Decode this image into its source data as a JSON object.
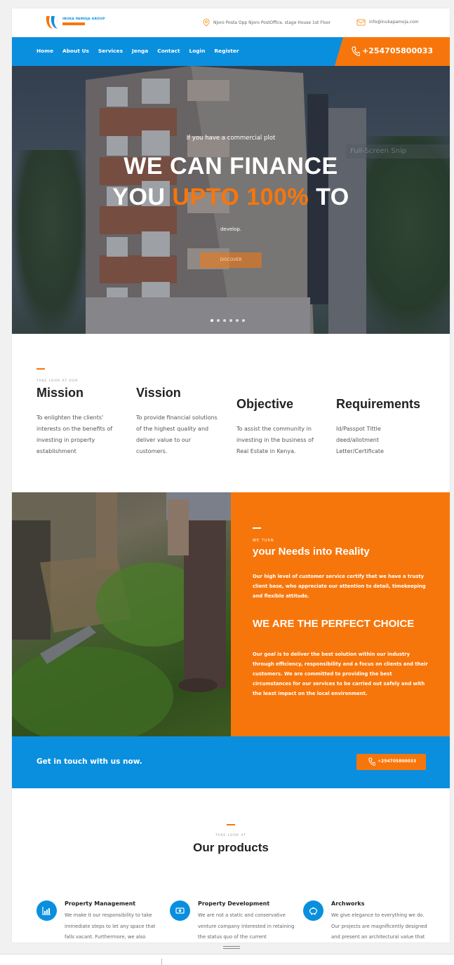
{
  "topbar": {
    "brand": "INUKA PAMOJA GROUP",
    "address": "Njoro Posta Opp Njoro PostOffice, stage House 1st Floor",
    "email": "info@inukapamoja.com"
  },
  "nav": {
    "items": [
      "Home",
      "About Us",
      "Services",
      "Jenga",
      "Contact",
      "Login",
      "Register"
    ],
    "phone": "+254705800033"
  },
  "hero": {
    "kicker": "If you have a commercial plot",
    "line1": "WE CAN FINANCE",
    "line2_a": "YOU ",
    "line2_accent": "UPTO 100%",
    "line2_b": " TO",
    "sub": "develop.",
    "button": "DISCOVER",
    "overlay": "Full-Screen Snip",
    "slides": 6,
    "active_slide": 1
  },
  "mission": {
    "kicker": "TAKE LOOK AT OUR",
    "columns": [
      {
        "title": "Mission",
        "text": "To enlighten the clients' interests on the benefits of investing in property establishment"
      },
      {
        "title": "Vission",
        "text": "To provide financial solutions of the highest quality and deliver value to our customers."
      },
      {
        "title": "Objective",
        "text": "To assist the community in investing in the business of Real Estate in Kenya."
      },
      {
        "title": "Requirements",
        "text": "Id/Passpot Tittle deed/allotment Letter/Certificate"
      }
    ]
  },
  "needs": {
    "kicker": "WE TURN",
    "title": "your Needs into Reality",
    "para1": "Our high level of customer service certify that we have a trusty client base, who appreciate our attention to detail, timekeeping and flexible attitude.",
    "title2": "WE ARE THE PERFECT CHOICE",
    "para2": "Our goal is to deliver the best solution within our industry through efficiency, responsibility and a focus on clients and their customers. We are committed to providing the best circumstances for our services to be carried out safely and with the least impact on the local environment."
  },
  "cta": {
    "text": "Get in touch with us now.",
    "phone": "+254705800033"
  },
  "products": {
    "kicker": "TAKE LOOK AT",
    "title": "Our products",
    "cards": [
      {
        "icon": "chart-icon",
        "title": "Property Management",
        "text": "We make it our responsibility to take immediate steps to let any space that falls vacant. Furthermore, we also undertake Project Management on"
      },
      {
        "icon": "money-icon",
        "title": "Property Development",
        "text": "We are not a static and conservative venture company interested in retaining the status quo of the current construction trends but rather a"
      },
      {
        "icon": "piggy-bank-icon",
        "title": "Archworks",
        "text": "We give elegance to everything we do. Our projects are magnificently designed and present an architectural value that stands out. We do this"
      }
    ]
  },
  "colors": {
    "blue": "#0a8fdf",
    "orange": "#f7760b"
  }
}
